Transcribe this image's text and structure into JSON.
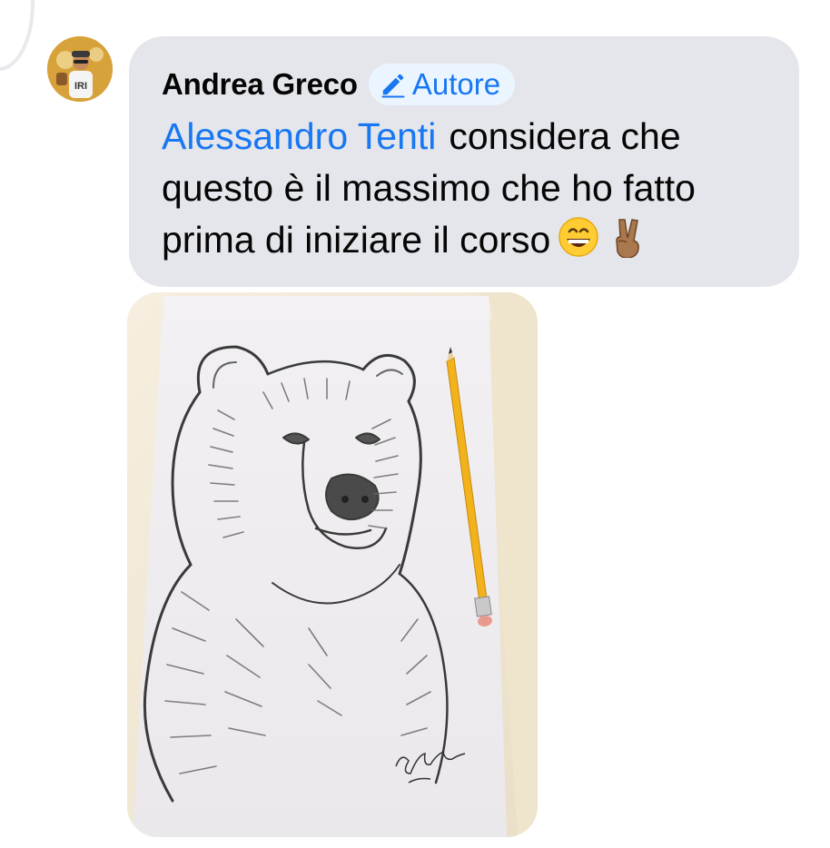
{
  "comment": {
    "author": {
      "name": "Andrea Greco",
      "avatar_icon": "user-avatar",
      "badge": {
        "label": "Autore",
        "icon": "pencil-icon"
      }
    },
    "mention": "Alessandro Tenti",
    "body": "considera che questo è il massimo che ho fatto prima di iniziare il corso",
    "emojis": [
      "grinning-face-emoji",
      "victory-hand-emoji"
    ],
    "attachment": {
      "type": "photo",
      "subject": "bear-drawing",
      "signature": "signature-scribble"
    }
  },
  "colors": {
    "bubble": "#e4e6eb",
    "link": "#1877f2",
    "badge_bg": "#ebf5ff",
    "text": "#050505"
  }
}
